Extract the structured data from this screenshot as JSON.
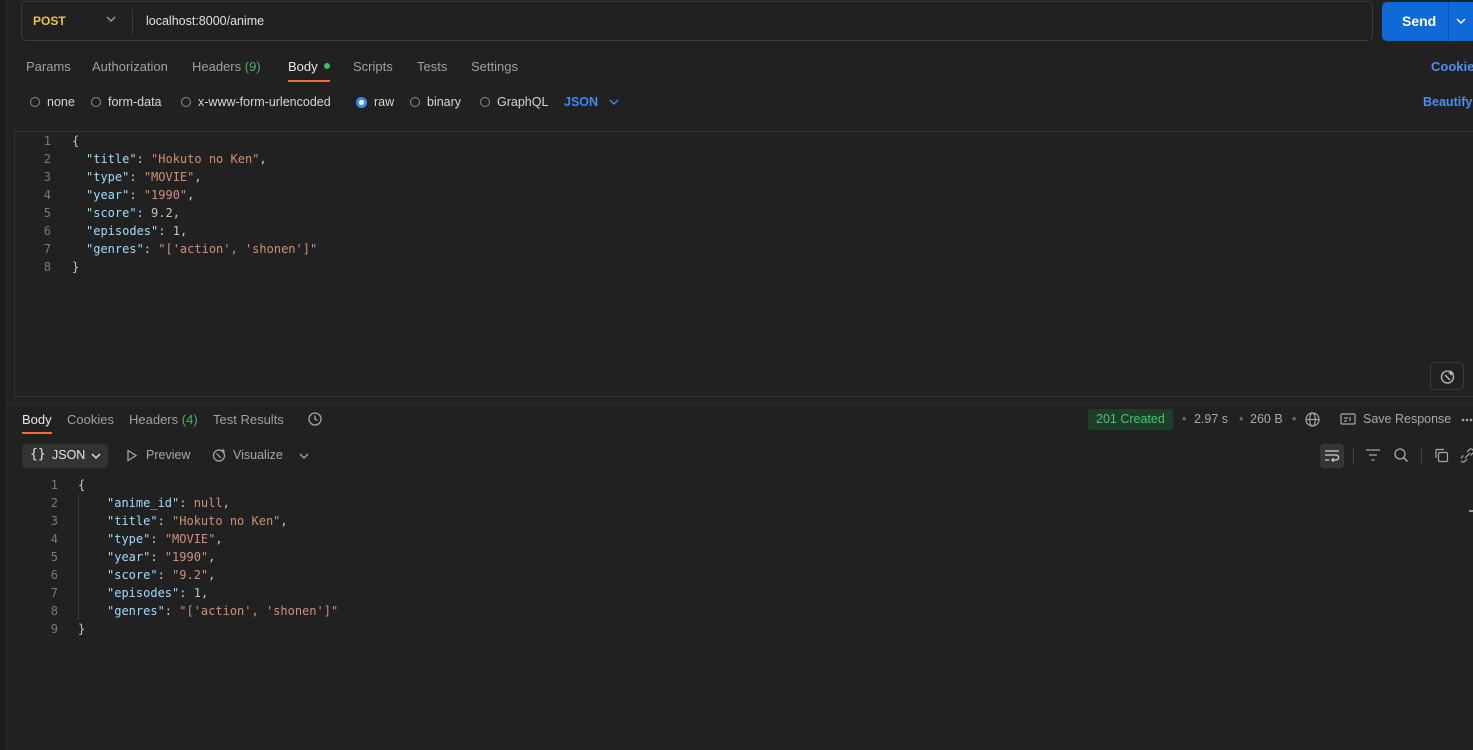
{
  "request": {
    "method": "POST",
    "url": "localhost:8000/anime",
    "send_label": "Send"
  },
  "request_tabs": [
    {
      "label": "Params"
    },
    {
      "label": "Authorization"
    },
    {
      "label": "Headers",
      "count": "(9)"
    },
    {
      "label": "Body",
      "active": true
    },
    {
      "label": "Scripts"
    },
    {
      "label": "Tests"
    },
    {
      "label": "Settings"
    }
  ],
  "cookies_label": "Cookies",
  "body_types": [
    "none",
    "form-data",
    "x-www-form-urlencoded",
    "raw",
    "binary",
    "GraphQL"
  ],
  "body_type_selected": "raw",
  "raw_format": "JSON",
  "beautify_label": "Beautify",
  "request_body_lines": [
    {
      "no": "1",
      "text": "{"
    },
    {
      "no": "2",
      "key": "\"title\"",
      "value": "\"Hokuto no Ken\"",
      "trail": ","
    },
    {
      "no": "3",
      "key": "\"type\"",
      "value": "\"MOVIE\"",
      "trail": ","
    },
    {
      "no": "4",
      "key": "\"year\"",
      "value": "\"1990\"",
      "trail": ","
    },
    {
      "no": "5",
      "key": "\"score\"",
      "value": "9.2",
      "trail": ","
    },
    {
      "no": "6",
      "key": "\"episodes\"",
      "value": "1",
      "trail": ","
    },
    {
      "no": "7",
      "key": "\"genres\"",
      "value": "\"['action', 'shonen']\"",
      "trail": ""
    },
    {
      "no": "8",
      "text": "}"
    }
  ],
  "response_tabs": [
    {
      "label": "Body",
      "active": true
    },
    {
      "label": "Cookies"
    },
    {
      "label": "Headers",
      "count": "(4)"
    },
    {
      "label": "Test Results"
    }
  ],
  "response_meta": {
    "status": "201 Created",
    "time": "2.97 s",
    "size": "260 B",
    "save_label": "Save Response"
  },
  "response_toolbar": {
    "format": "JSON",
    "preview": "Preview",
    "visualize": "Visualize"
  },
  "response_body_lines": [
    {
      "no": "1",
      "text": "{"
    },
    {
      "no": "2",
      "key": "\"anime_id\"",
      "value": "null",
      "trail": ","
    },
    {
      "no": "3",
      "key": "\"title\"",
      "value": "\"Hokuto no Ken\"",
      "trail": ","
    },
    {
      "no": "4",
      "key": "\"type\"",
      "value": "\"MOVIE\"",
      "trail": ","
    },
    {
      "no": "5",
      "key": "\"year\"",
      "value": "\"1990\"",
      "trail": ","
    },
    {
      "no": "6",
      "key": "\"score\"",
      "value": "\"9.2\"",
      "trail": ","
    },
    {
      "no": "7",
      "key": "\"episodes\"",
      "value": "1",
      "trail": ","
    },
    {
      "no": "8",
      "key": "\"genres\"",
      "value": "\"['action', 'shonen']\"",
      "trail": ""
    },
    {
      "no": "9",
      "text": "}"
    }
  ],
  "icons": {
    "method_dropdown": "chevron-down-icon",
    "send_dropdown": "chevron-down-icon",
    "history": "history-icon",
    "globe": "globe-icon",
    "save": "save-response-icon",
    "more": "more-icon",
    "preview": "play-icon",
    "visualize": "visualize-icon",
    "wrap": "wrap-lines-icon",
    "filter": "filter-icon",
    "search": "search-icon",
    "copy": "copy-icon",
    "link": "link-icon",
    "magic": "ai-assist-icon"
  },
  "colors": {
    "accent_blue": "#0f6ad8",
    "tab_underline": "#f26b3a",
    "status_green": "#49c46f",
    "method_yellow": "#e8c547"
  }
}
